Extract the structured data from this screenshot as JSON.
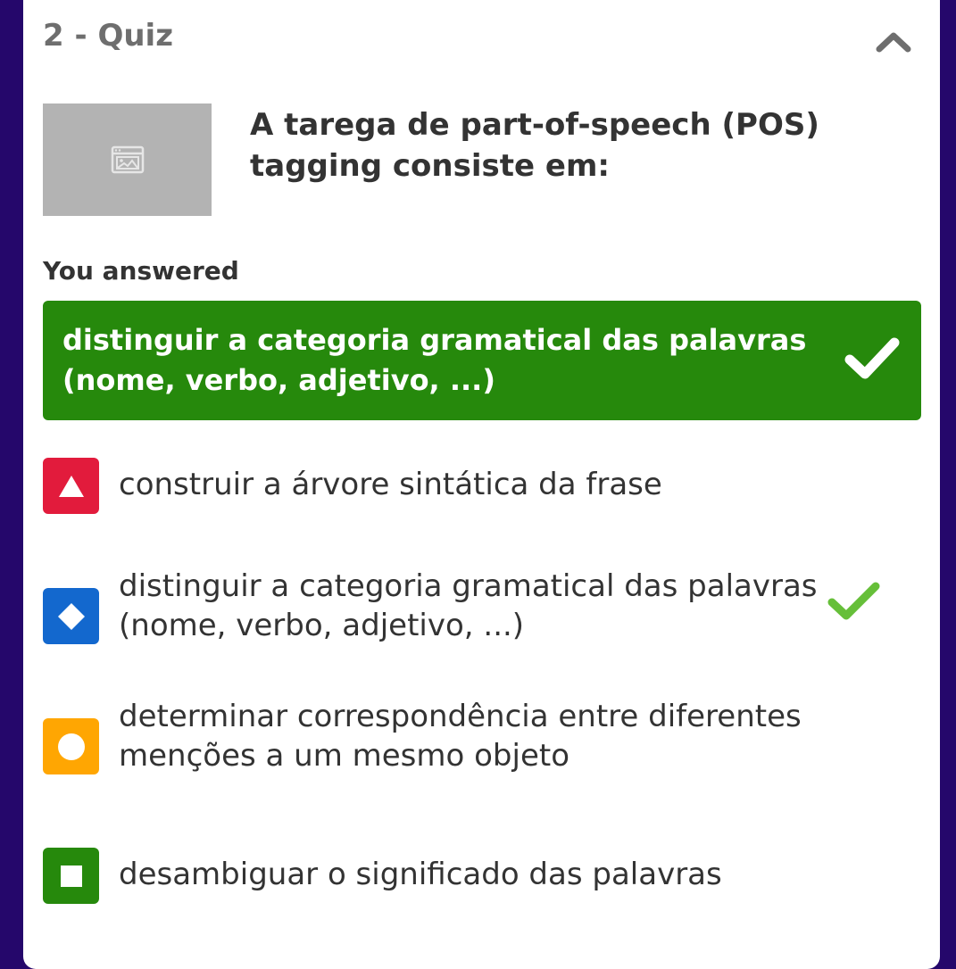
{
  "quiz": {
    "title": "2 - Quiz",
    "question": "A tarega de part-of-speech (POS) tagging consiste em:"
  },
  "icons": {
    "collapse": "chevron-up-icon",
    "image_placeholder": "image-placeholder-icon",
    "check": "checkmark-icon"
  },
  "answered": {
    "label": "You answered",
    "text": "distinguir a categoria gramatical das palavras (nome, verbo, adjetivo, ...)",
    "correct": true,
    "color": "#26890c"
  },
  "options": [
    {
      "shape": "triangle",
      "color": "#e21b3c",
      "text": "construir a árvore sintática da frase",
      "correct": false
    },
    {
      "shape": "diamond",
      "color": "#1368ce",
      "text": "distinguir a categoria gramatical das palavras (nome, verbo, adjetivo, ...)",
      "correct": true
    },
    {
      "shape": "circle",
      "color": "#ffa602",
      "text": "determinar correspondência entre diferentes menções a um mesmo objeto",
      "correct": false
    },
    {
      "shape": "square",
      "color": "#26890c",
      "text": "desambiguar o significado das palavras",
      "correct": false
    }
  ],
  "colors": {
    "background": "#25076b",
    "correct_check": "#66bf39"
  }
}
